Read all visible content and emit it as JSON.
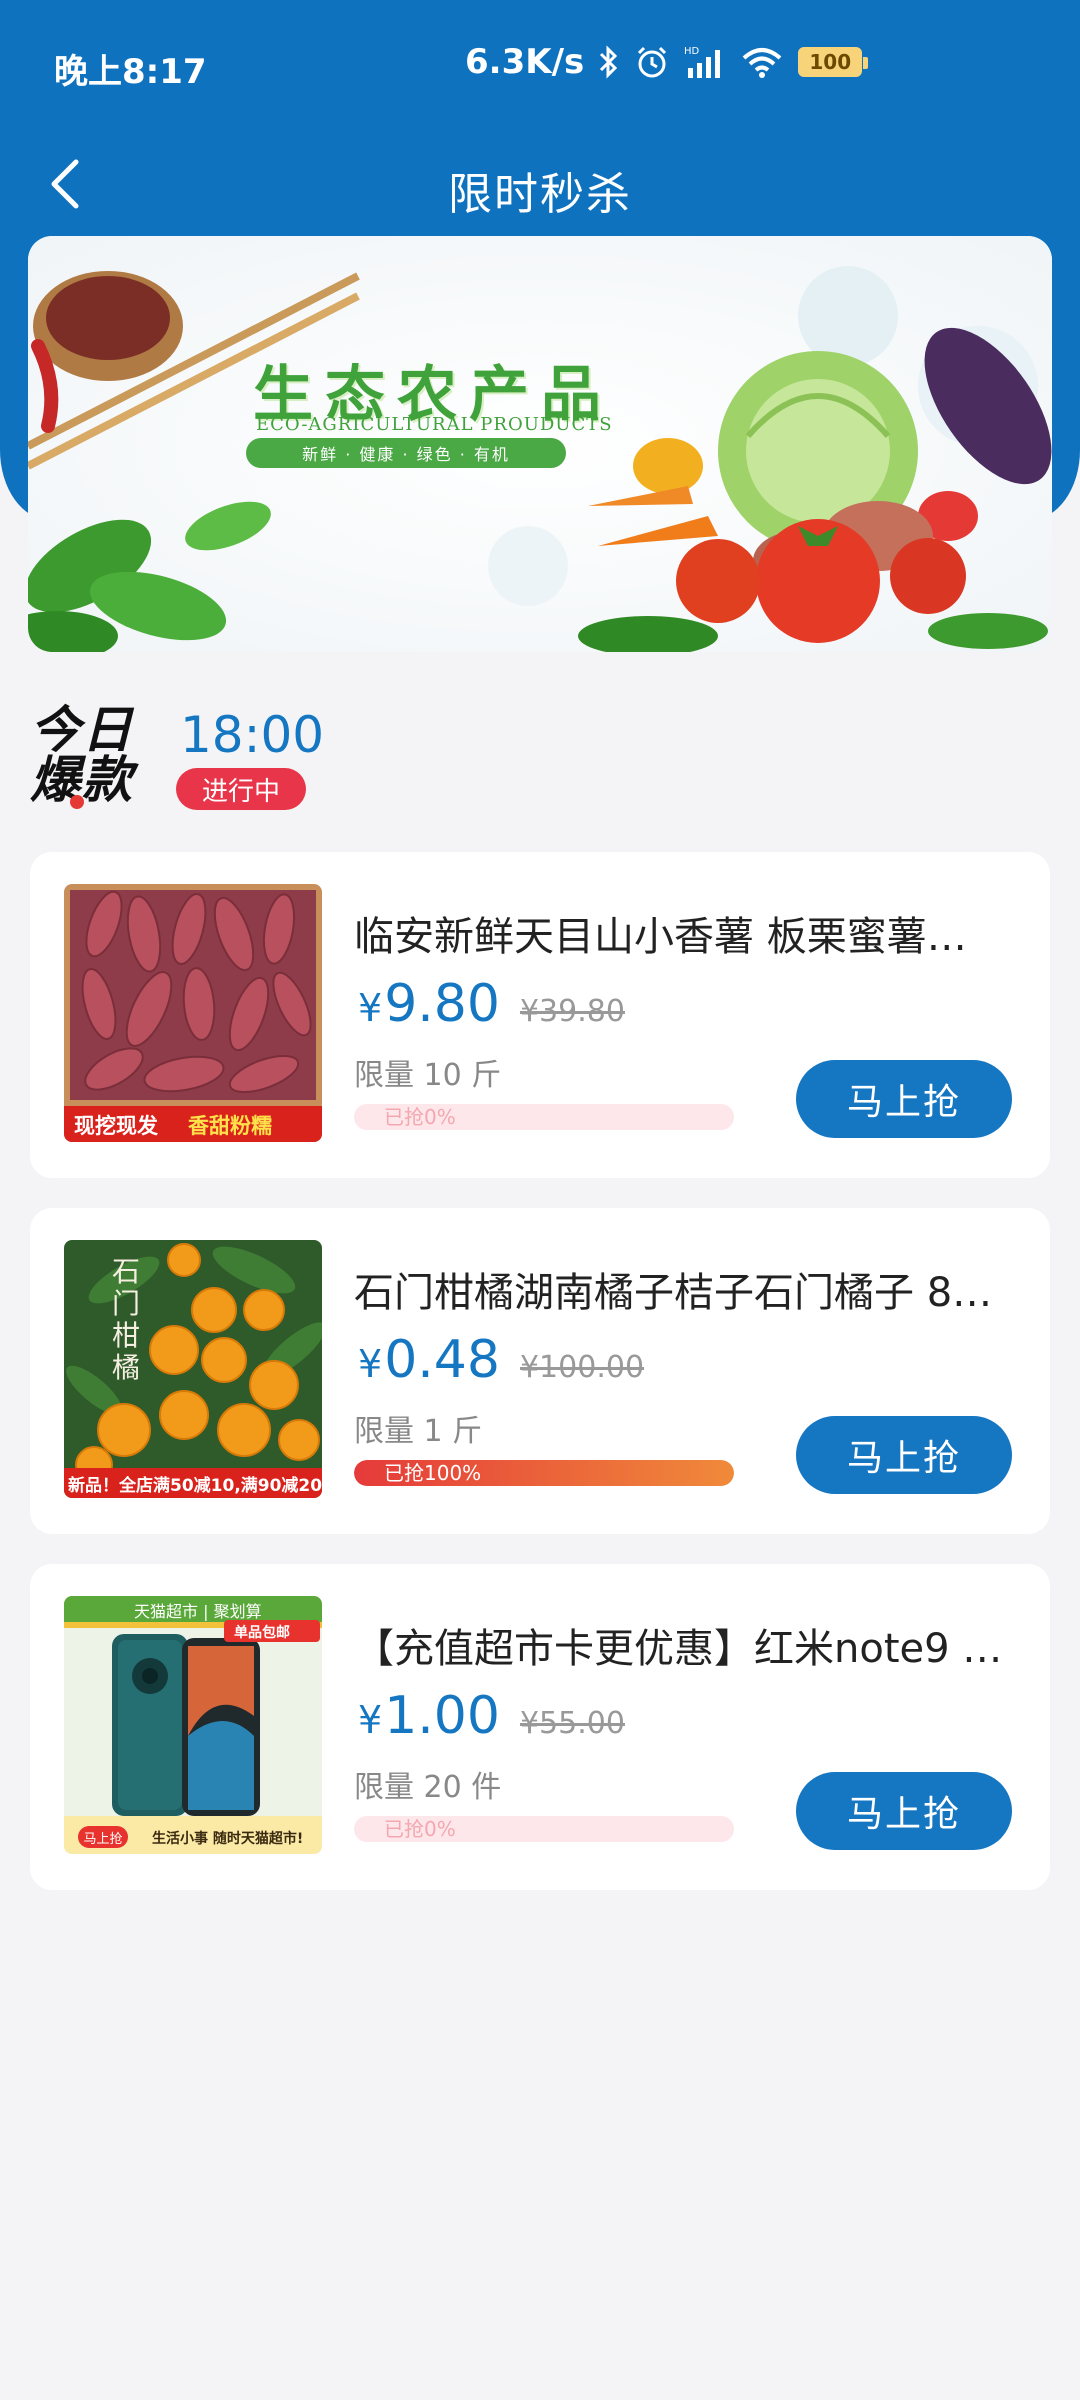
{
  "status_bar": {
    "time": "晚上8:17",
    "net_speed": "6.3K/s",
    "battery": "100",
    "icons": [
      "bluetooth-icon",
      "alarm-icon",
      "signal-icon",
      "wifi-icon",
      "battery-icon"
    ]
  },
  "nav": {
    "title": "限时秒杀",
    "back_icon": "chevron-left-icon"
  },
  "banner": {
    "title": "生态农产品",
    "subtitle": "ECO-AGRICULTURAL PROUDUCTS",
    "tags": "新鲜 · 健康 · 绿色 · 有机"
  },
  "session": {
    "logo_line1": "今日",
    "logo_line2": "爆款",
    "time": "18:00",
    "status": "进行中"
  },
  "colors": {
    "primary": "#0f72bf",
    "price": "#1576c2",
    "badge": "#e8354a",
    "progress_fill": "#e53a3a",
    "background": "#f4f4f7"
  },
  "products": [
    {
      "title": "临安新鲜天目山小香薯 板栗蜜薯…",
      "currency": "¥",
      "price": "9.80",
      "original_price": "¥39.80",
      "limit": "限量  10 斤",
      "sold_text": "已抢0%",
      "sold_percent": 0,
      "button": "马上抢",
      "thumb_caption_left": "现挖现发",
      "thumb_caption_right": "香甜粉糯"
    },
    {
      "title": "石门柑橘湖南橘子桔子石门橘子 8…",
      "currency": "¥",
      "price": "0.48",
      "original_price": "¥100.00",
      "limit": "限量  1 斤",
      "sold_text": "已抢100%",
      "sold_percent": 100,
      "button": "马上抢",
      "thumb_caption": "新品！全店满50减10,满90减20",
      "thumb_overlay": "石门柑橘"
    },
    {
      "title": "【充值超市卡更优惠】红米note9 …",
      "currency": "¥",
      "price": "1.00",
      "original_price": "¥55.00",
      "limit": "限量  20 件",
      "sold_text": "已抢0%",
      "sold_percent": 0,
      "button": "马上抢",
      "thumb_header": "天猫超市 | 聚划算",
      "thumb_badge": "单品包邮",
      "thumb_footer": "生活小事 随时天猫超市!",
      "thumb_button": "马上抢"
    }
  ]
}
